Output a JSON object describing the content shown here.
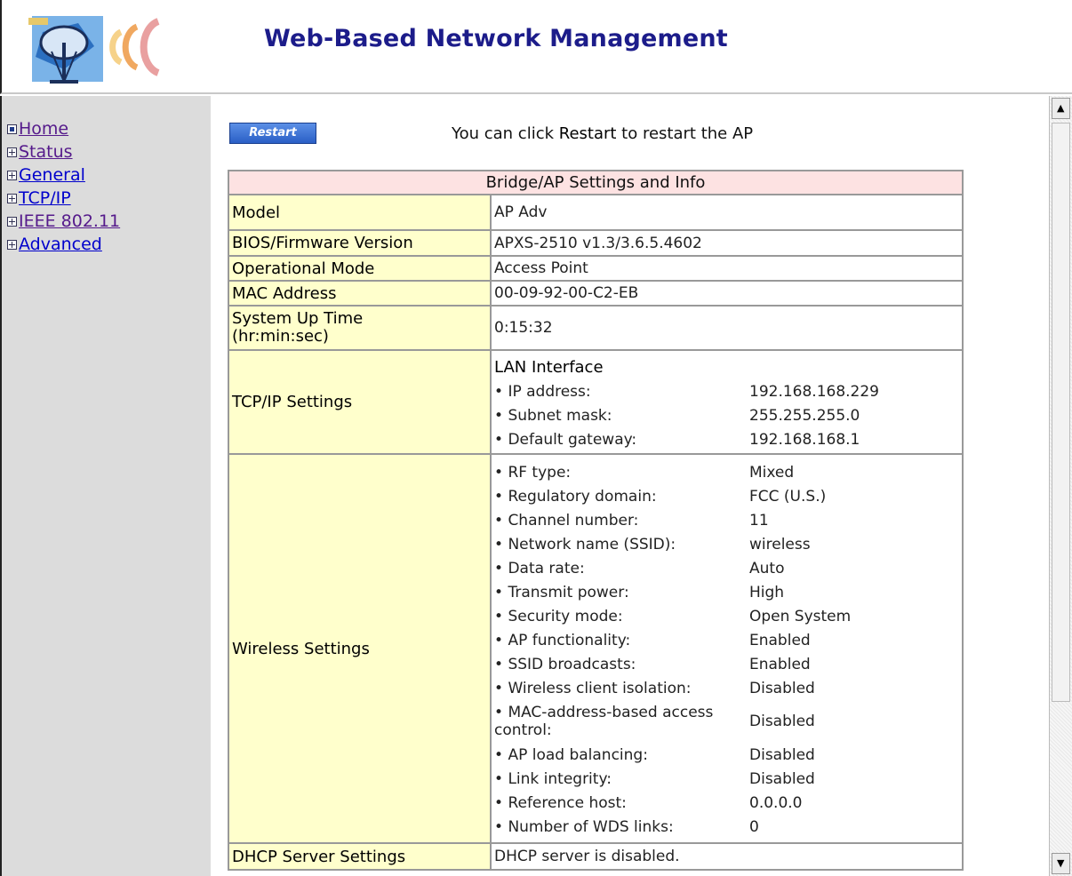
{
  "header": {
    "title": "Web-Based Network Management",
    "logo_icon": "satellite-dish-logo-icon"
  },
  "nav": {
    "items": [
      {
        "label": "Home",
        "icon": "minus-box-icon",
        "visited": true
      },
      {
        "label": "Status",
        "icon": "plus-box-icon",
        "visited": true
      },
      {
        "label": "General",
        "icon": "plus-box-icon",
        "visited": false
      },
      {
        "label": "TCP/IP",
        "icon": "plus-box-icon",
        "visited": false
      },
      {
        "label": "IEEE 802.11",
        "icon": "plus-box-icon",
        "visited": true
      },
      {
        "label": "Advanced",
        "icon": "plus-box-icon",
        "visited": false
      }
    ]
  },
  "restart": {
    "button_label": "Restart",
    "hint_before": "You can click ",
    "hint_bold": "Restart",
    "hint_after": " to restart the AP"
  },
  "table": {
    "caption": "Bridge/AP Settings and Info",
    "model": {
      "label": "Model",
      "value": "AP Adv"
    },
    "firmware": {
      "label": "BIOS/Firmware Version",
      "value": "APXS-2510 v1.3/3.6.5.4602"
    },
    "mode": {
      "label": "Operational Mode",
      "value": "Access Point"
    },
    "mac": {
      "label": "MAC Address",
      "value": "00-09-92-00-C2-EB"
    },
    "uptime": {
      "label_line1": "System Up Time",
      "label_line2": "(hr:min:sec)",
      "value": "0:15:32"
    },
    "tcpip": {
      "label": "TCP/IP Settings",
      "heading": "LAN Interface",
      "rows": [
        {
          "key": "IP address:",
          "value": "192.168.168.229"
        },
        {
          "key": "Subnet mask:",
          "value": "255.255.255.0"
        },
        {
          "key": "Default gateway:",
          "value": "192.168.168.1"
        }
      ]
    },
    "wireless": {
      "label": "Wireless Settings",
      "rows": [
        {
          "key": "RF type:",
          "value": "Mixed"
        },
        {
          "key": "Regulatory domain:",
          "value": "FCC (U.S.)"
        },
        {
          "key": "Channel number:",
          "value": "11"
        },
        {
          "key": "Network name (SSID):",
          "value": "wireless"
        },
        {
          "key": "Data rate:",
          "value": "Auto"
        },
        {
          "key": "Transmit power:",
          "value": "High"
        },
        {
          "key": "Security mode:",
          "value": "Open System"
        },
        {
          "key": "AP functionality:",
          "value": "Enabled"
        },
        {
          "key": "SSID broadcasts:",
          "value": "Enabled"
        },
        {
          "key": "Wireless client isolation:",
          "value": "Disabled"
        },
        {
          "key": "MAC-address-based access control:",
          "value": "Disabled"
        },
        {
          "key": "AP load balancing:",
          "value": "Disabled"
        },
        {
          "key": "Link integrity:",
          "value": "Disabled"
        },
        {
          "key": "Reference host:",
          "value": "0.0.0.0"
        },
        {
          "key": "Number of WDS links:",
          "value": "0"
        }
      ]
    },
    "dhcp": {
      "label": "DHCP Server Settings",
      "value": "DHCP server is disabled."
    }
  },
  "scrollbar": {
    "up_icon": "scroll-up-arrow-icon",
    "down_icon": "scroll-down-arrow-icon"
  }
}
